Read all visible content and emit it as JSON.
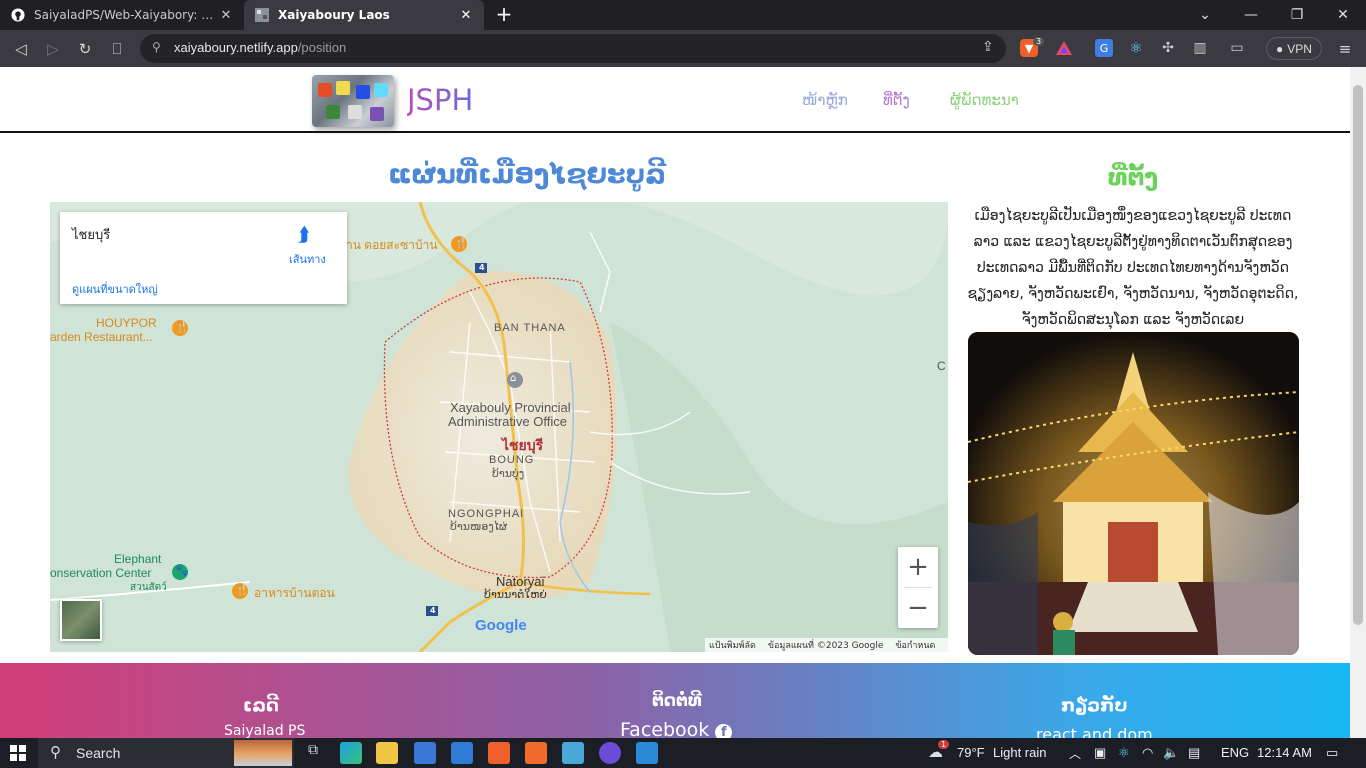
{
  "browser": {
    "tabs": [
      {
        "title": "SaiyaladPS/Web-Xaiyabory: ພາບພັດທະນາ",
        "active": false
      },
      {
        "title": "Xaiyaboury Laos",
        "active": true
      }
    ],
    "new_tab": "+",
    "address": {
      "host": "xaiyaboury.netlify.app",
      "path": "/position"
    },
    "vpn_label": "VPN",
    "brave_badge": "3"
  },
  "nav": {
    "brand": "JSPH",
    "links": [
      "ໜ້າຫຼັກ",
      "ທີ່ຕັ້ງ",
      "ຜູ້ພັດທະນາ"
    ]
  },
  "map_section": {
    "title": "ແຜ່ນທີ່ເມືອງໄຊຍະບູລີ",
    "info_card": {
      "place": "ไชยบุรี",
      "directions": "เส้นทาง",
      "larger_map": "ดูแผนที่ขนาดใหญ่"
    },
    "labels": {
      "restaurant_top": "าน ดอยสะซาบ้าน",
      "houypor_1": "HOUYPOR",
      "houypor_2": "arden Restaurant...",
      "ban_thana": "BAN THANA",
      "office_1": "Xayabouly Provincial",
      "office_2": "Administrative Office",
      "city_red": "ไชยบุรี",
      "boung_en": "BOUNG",
      "boung_lo": "ບ້ານບຸ່ງ",
      "ngongphai_en": "NGONGPHAI",
      "ngongphai_lo": "ບ້ານໜອງໄຜ່",
      "elephant_1": "Elephant",
      "elephant_2": "onservation Center",
      "elephant_3": "สวนสัตว์",
      "restaurant_bottom": "อาหารบ้านตอน",
      "natoryai_en": "Natoryai",
      "natoryai_lo": "ບ້ານນາຕໍໃຫຍ່",
      "edge_c": "C",
      "road_4": "4",
      "google": "Google"
    },
    "zoom_in": "+",
    "zoom_out": "−",
    "footer_links": [
      "แป้นพิมพ์ลัด",
      "ข้อมูลแผนที่ ©2023 Google",
      "ข้อกำหนด"
    ]
  },
  "side": {
    "title": "ທີ່ຕັ້ງ",
    "text": "ເມືອງໄຊຍະບູລີເປັນເມືອງໜຶ່ງຂອງແຂວງໄຊຍະບູລີ ປະເທດລາວ ແລະ ແຂວງໄຊຍະບູລີຕັ້ງຢູ່ທາງທິດຕາເວັນຕົກສຸດຂອງປະເທດລາວ ມີພື້ນທີ່ຕິດກັບ ປະເທດໄທຍທາງດ້ານຈັງຫວັດຊຽງລາຍ, ຈັງຫວັດພະເຢົາ, ຈັງຫວັດນານ, ຈັງຫວັດອຸຕະດິດ, ຈັງຫວັດພິດສະນຸໂລກ ແລະ ຈັງຫວັດເລຍ"
  },
  "footer": {
    "col1_title": "ເລດີ",
    "col1_sub": "Saiyalad PS",
    "col2_title": "ຕິດຕໍ່ທີ",
    "col2_sub": "Facebook",
    "col3_title": "ກຽ່ວກັບ",
    "col3_sub": "react and dom"
  },
  "taskbar": {
    "search": "Search",
    "weather_temp": "79°F",
    "weather_text": "Light rain",
    "weather_badge": "1",
    "lang": "ENG",
    "time": "12:14 AM"
  },
  "colors": {
    "map_title": "#4e88d8",
    "side_title": "#6bd35a",
    "footer_gradient": [
      "#d23e78",
      "#8a64a8",
      "#18b8f4"
    ]
  }
}
